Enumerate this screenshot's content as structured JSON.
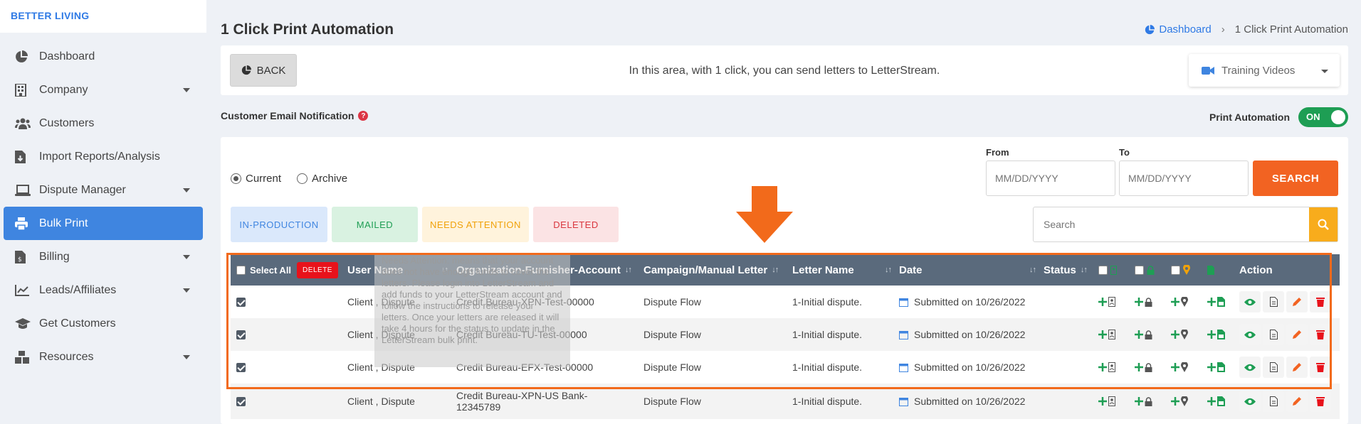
{
  "brand": "BETTER LIVING",
  "sidebar": {
    "items": [
      {
        "label": "Dashboard",
        "icon": "pie-chart-icon",
        "caret": false,
        "active": false
      },
      {
        "label": "Company",
        "icon": "building-icon",
        "caret": true,
        "active": false
      },
      {
        "label": "Customers",
        "icon": "users-icon",
        "caret": false,
        "active": false
      },
      {
        "label": "Import Reports/Analysis",
        "icon": "file-import-icon",
        "caret": false,
        "active": false
      },
      {
        "label": "Dispute Manager",
        "icon": "laptop-icon",
        "caret": true,
        "active": false
      },
      {
        "label": "Bulk Print",
        "icon": "print-icon",
        "caret": false,
        "active": true
      },
      {
        "label": "Billing",
        "icon": "invoice-icon",
        "caret": true,
        "active": false
      },
      {
        "label": "Leads/Affiliates",
        "icon": "chart-line-icon",
        "caret": true,
        "active": false
      },
      {
        "label": "Get Customers",
        "icon": "graduation-cap-icon",
        "caret": false,
        "active": false
      },
      {
        "label": "Resources",
        "icon": "boxes-icon",
        "caret": true,
        "active": false
      }
    ]
  },
  "header": {
    "title": "1 Click Print Automation",
    "breadcrumb_home": "Dashboard",
    "breadcrumb_current": "1 Click Print Automation"
  },
  "topbar": {
    "back_label": "BACK",
    "info": "In this area, with 1 click, you can send letters to LetterStream.",
    "training_label": "Training Videos"
  },
  "notification": {
    "label": "Customer Email Notification",
    "automation_label": "Print Automation",
    "toggle_label": "ON"
  },
  "filters": {
    "radio_current": "Current",
    "radio_archive": "Archive",
    "from_label": "From",
    "to_label": "To",
    "date_placeholder": "MM/DD/YYYY",
    "search_button": "SEARCH",
    "search_placeholder": "Search",
    "tabs": [
      "IN-PRODUCTION",
      "MAILED",
      "NEEDS ATTENTION",
      "DELETED"
    ]
  },
  "table": {
    "select_all": "Select All",
    "delete_label": "DELETE",
    "headers": {
      "user": "User Name",
      "org": "Organization-Furnisher-Account",
      "campaign": "Campaign/Manual Letter",
      "letter": "Letter Name",
      "date": "Date",
      "status": "Status",
      "action": "Action"
    },
    "rows": [
      {
        "user": "Client , Dispute",
        "org": "Credit Bureau-XPN-Test-00000",
        "campaign": "Dispute Flow",
        "letter": "1-Initial dispute.",
        "date": "Submitted on 10/26/2022"
      },
      {
        "user": "Client , Dispute",
        "org": "Credit Bureau-TU-Test-00000",
        "campaign": "Dispute Flow",
        "letter": "1-Initial dispute.",
        "date": "Submitted on 10/26/2022"
      },
      {
        "user": "Client , Dispute",
        "org": "Credit Bureau-EFX-Test-00000",
        "campaign": "Dispute Flow",
        "letter": "1-Initial dispute.",
        "date": "Submitted on 10/26/2022"
      },
      {
        "user": "Client , Dispute",
        "org": "Credit Bureau-XPN-US Bank-12345789",
        "campaign": "Dispute Flow",
        "letter": "1-Initial dispute.",
        "date": "Submitted on 10/26/2022"
      }
    ]
  },
  "tooltip": "Needs Attention: means that your account does not have enough funds to cover the letters. Please login into LetterStream and add funds to your LetterStream account and follow the instructions to release your letters. Once your letters are released it will take 4 hours for the status to update in the LetterStream bulk print.",
  "colors": {
    "accent": "#3f85e0",
    "orange": "#f26322",
    "header": "#5a6a7c",
    "green": "#1e9e54",
    "red": "#e8121b"
  }
}
